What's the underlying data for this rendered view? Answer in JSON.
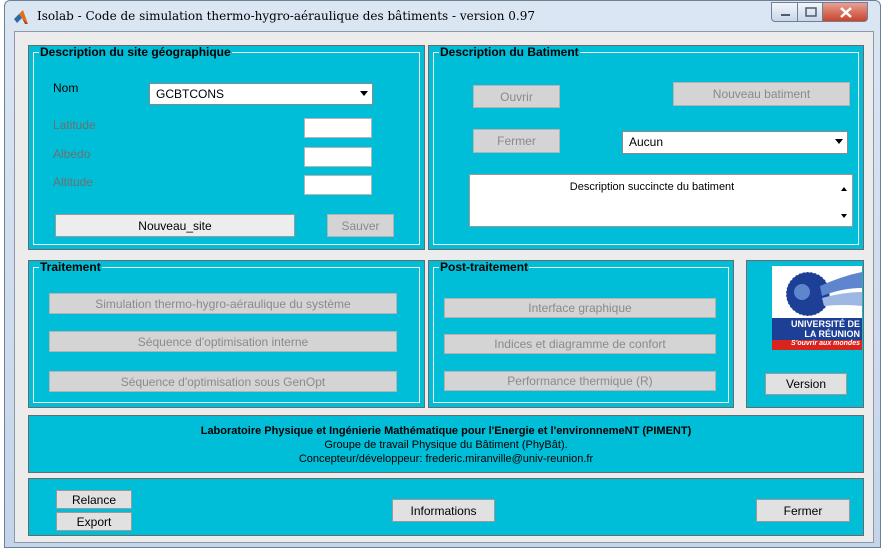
{
  "window": {
    "title": "Isolab - Code de simulation thermo-hygro-aéraulique des bâtiments  -  version 0.97"
  },
  "site": {
    "title": "Description du site géographique",
    "nom_label": "Nom",
    "nom_value": "GCBTCONS",
    "latitude_label": "Latitude",
    "albedo_label": "Albédo",
    "altitude_label": "Altitude",
    "nouveau_label": "Nouveau_site",
    "sauver_label": "Sauver"
  },
  "batiment": {
    "title": "Description du Batiment",
    "ouvrir_label": "Ouvrir",
    "nouveau_label": "Nouveau batiment",
    "fermer_label": "Fermer",
    "select_value": "Aucun",
    "description": "Description succincte du batiment"
  },
  "traitement": {
    "title": "Traitement",
    "buttons": [
      "Simulation thermo-hygro-aéraulique du système",
      "Séquence d'optimisation interne",
      "Séquence d'optimisation sous GenOpt"
    ]
  },
  "post": {
    "title": "Post-traitement",
    "buttons": [
      "Interface graphique",
      "Indices et diagramme de confort",
      "Performance thermique (R)"
    ]
  },
  "logo": {
    "line1": "UNIVERSITÉ DE",
    "line2": "LA RÉUNION",
    "slogan": "S'ouvrir aux mondes"
  },
  "version_label": "Version",
  "info": {
    "line1": "Laboratoire  Physique et Ingénierie Mathématique pour l'Energie et l'environnemeNT (PIMENT)",
    "line2": "Groupe de travail Physique du Bâtiment (PhyBât).",
    "line3": "Concepteur/développeur: frederic.miranville@univ-reunion.fr"
  },
  "footer": {
    "relance_label": "Relance",
    "export_label": "Export",
    "informations_label": "Informations",
    "fermer_label": "Fermer"
  },
  "colors": {
    "panel": "#00bed8",
    "logo_blue": "#1d3f96",
    "logo_red": "#d8241c"
  }
}
